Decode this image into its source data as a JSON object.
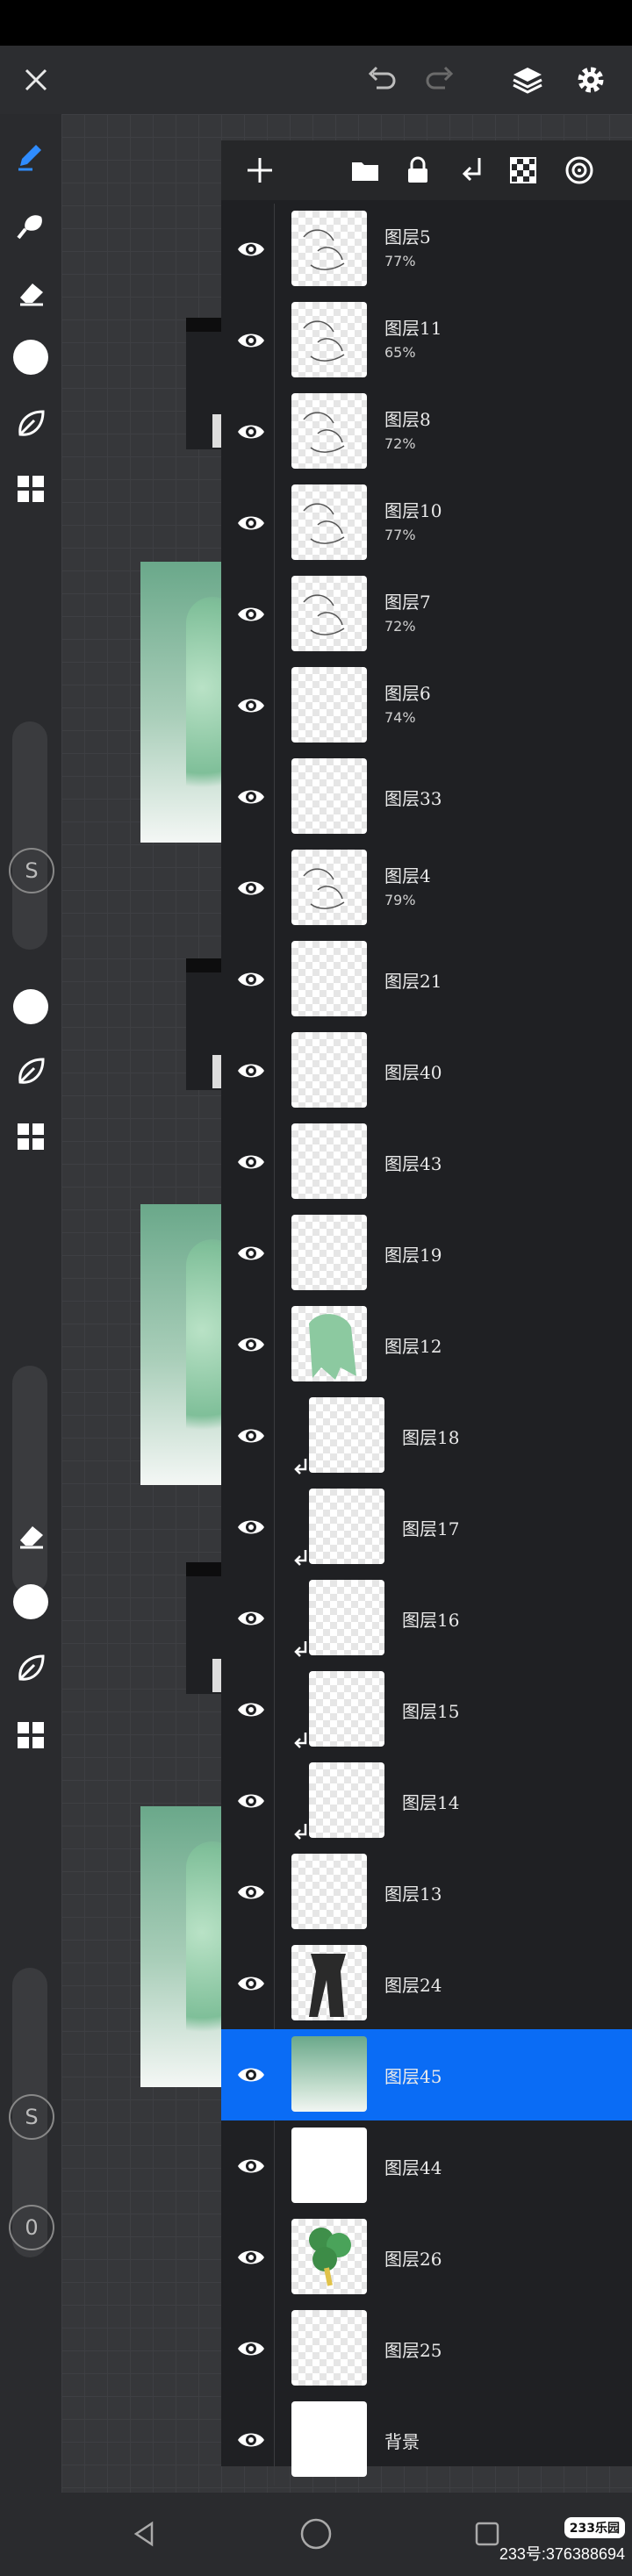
{
  "top_bar": {
    "close_icon": "close-icon",
    "undo_icon": "undo-icon",
    "redo_icon": "redo-icon",
    "layers_icon": "layers-icon",
    "settings_icon": "gear-icon"
  },
  "toolbar": {
    "tools": [
      "pen-icon",
      "smudge-icon",
      "eraser-icon",
      "color-dot",
      "leaf-icon",
      "grid-icon"
    ],
    "slider_s_label": "S",
    "slider_o_label": "0"
  },
  "panel_toolbar": [
    "add-layer-icon",
    "folder-icon",
    "lock-icon",
    "merge-down-icon",
    "checker-icon",
    "target-icon"
  ],
  "layers": [
    {
      "name": "图层5",
      "opacity": "77%",
      "thumb": "sketch"
    },
    {
      "name": "图层11",
      "opacity": "65%",
      "thumb": "sketch"
    },
    {
      "name": "图层8",
      "opacity": "72%",
      "thumb": "sketch"
    },
    {
      "name": "图层10",
      "opacity": "77%",
      "thumb": "sketch"
    },
    {
      "name": "图层7",
      "opacity": "72%",
      "thumb": "sketch"
    },
    {
      "name": "图层6",
      "opacity": "74%",
      "thumb": "transparent"
    },
    {
      "name": "图层33",
      "opacity": "",
      "thumb": "transparent"
    },
    {
      "name": "图层4",
      "opacity": "79%",
      "thumb": "sketch"
    },
    {
      "name": "图层21",
      "opacity": "",
      "thumb": "transparent"
    },
    {
      "name": "图层40",
      "opacity": "",
      "thumb": "transparent"
    },
    {
      "name": "图层43",
      "opacity": "",
      "thumb": "transparent"
    },
    {
      "name": "图层19",
      "opacity": "",
      "thumb": "transparent"
    },
    {
      "name": "图层12",
      "opacity": "",
      "thumb": "hair"
    },
    {
      "name": "图层18",
      "opacity": "",
      "thumb": "transparent",
      "clipped": true
    },
    {
      "name": "图层17",
      "opacity": "",
      "thumb": "transparent",
      "clipped": true
    },
    {
      "name": "图层16",
      "opacity": "",
      "thumb": "transparent",
      "clipped": true
    },
    {
      "name": "图层15",
      "opacity": "",
      "thumb": "transparent",
      "clipped": true
    },
    {
      "name": "图层14",
      "opacity": "",
      "thumb": "transparent",
      "clipped": true
    },
    {
      "name": "图层13",
      "opacity": "",
      "thumb": "transparent"
    },
    {
      "name": "图层24",
      "opacity": "",
      "thumb": "dark"
    },
    {
      "name": "图层45",
      "opacity": "",
      "thumb": "green",
      "selected": true
    },
    {
      "name": "图层44",
      "opacity": "",
      "thumb": "solid"
    },
    {
      "name": "图层26",
      "opacity": "",
      "thumb": "clover"
    },
    {
      "name": "图层25",
      "opacity": "",
      "thumb": "transparent"
    },
    {
      "name": "背景",
      "opacity": "",
      "thumb": "solid"
    }
  ],
  "nav_bar": [
    "back-icon",
    "home-icon",
    "recents-icon"
  ],
  "watermark": {
    "logo": "233乐园",
    "text": "233号:376388694"
  },
  "colors": {
    "selected": "#0a6cf5",
    "panel_bg": "#1f2023",
    "toolbar_bg": "#2a2b2e"
  }
}
